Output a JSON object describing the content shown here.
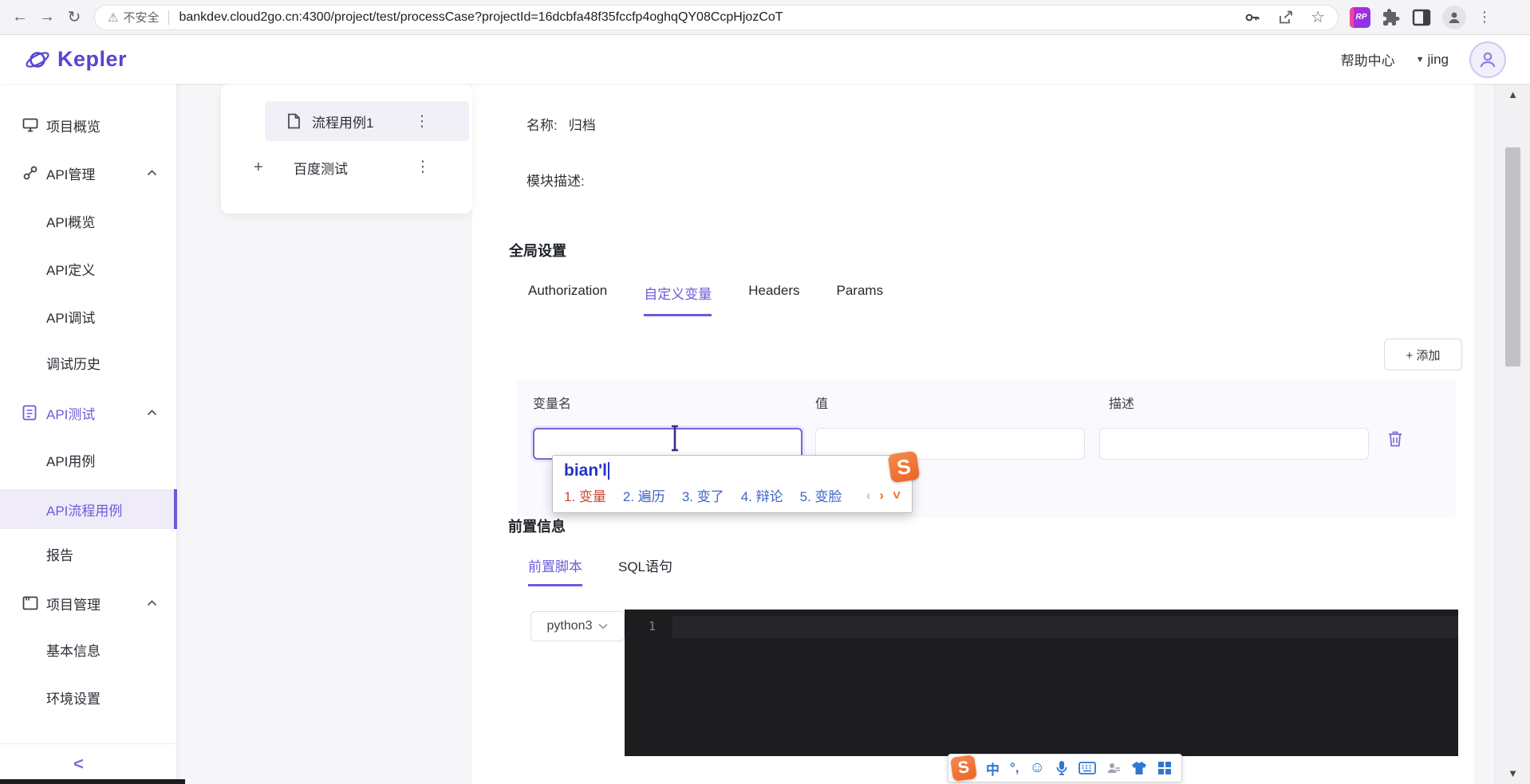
{
  "browser": {
    "security_label": "不安全",
    "url": "bankdev.cloud2go.cn:4300/project/test/processCase?projectId=16dcbfa48f35fccfp4oghqQY08CcpHjozCoT"
  },
  "header": {
    "brand": "Kepler",
    "help_label": "帮助中心",
    "username": "jing"
  },
  "sidebar": {
    "items": [
      "项目概览",
      "API管理",
      "API概览",
      "API定义",
      "API调试",
      "调试历史",
      "API测试",
      "API用例",
      "API流程用例",
      "报告",
      "项目管理",
      "基本信息",
      "环境设置"
    ],
    "collapse_label": "<"
  },
  "tree": {
    "add_label": "+",
    "items": [
      "流程用例1",
      "百度测试"
    ]
  },
  "main": {
    "name_label": "名称:",
    "name_value": "归档",
    "module_desc_label": "模块描述:",
    "global_settings_title": "全局设置",
    "tabs": [
      "Authorization",
      "自定义变量",
      "Headers",
      "Params"
    ],
    "active_tab": "自定义变量",
    "add_button_label": "+ 添加",
    "table_columns": [
      "变量名",
      "值",
      "描述"
    ],
    "pre_info_title": "前置信息",
    "pre_tabs": [
      "前置脚本",
      "SQL语句"
    ],
    "active_pre_tab": "前置脚本",
    "lang_select_value": "python3",
    "editor_first_line_number": "1"
  },
  "ime": {
    "composition": "bian'l",
    "candidates": [
      "1. 变量",
      "2. 遍历",
      "3. 变了",
      "4. 辩论",
      "5. 变脸"
    ],
    "prev": "‹",
    "next": "›",
    "fold": "˅",
    "brand_letter": "S",
    "toolbar": {
      "mode_cn": "中",
      "punct": "°,",
      "smiley": "☺"
    }
  },
  "icons": {
    "back": "←",
    "forward": "→",
    "reload": "↻",
    "warning": "⚠",
    "star": "☆",
    "kebab": "⋮",
    "menu_dots": "⋮",
    "caret_down": "▼",
    "scroll_up": "▲",
    "scroll_down": "▼"
  },
  "colors": {
    "accent": "#6a5cd8",
    "sogou_orange": "#ef6a2e",
    "ime_text_blue": "#2335c5",
    "candidate_blue": "#3f63c9",
    "candidate_first_red": "#cf4436",
    "editor_bg": "#1d1d20"
  }
}
